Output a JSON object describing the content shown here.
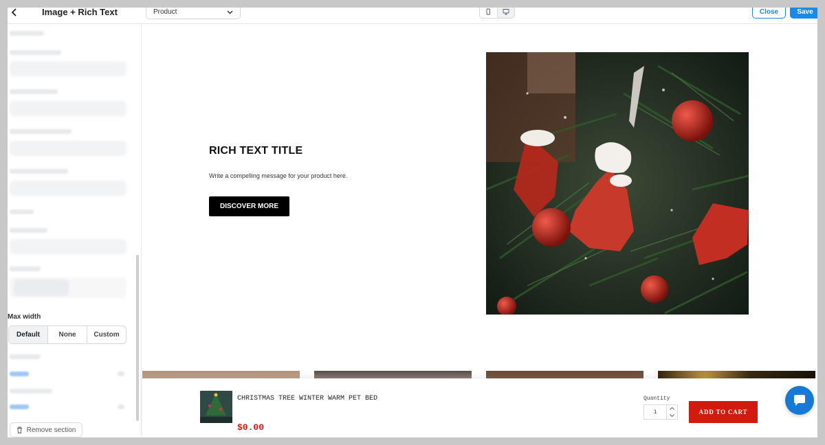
{
  "header": {
    "title": "Image + Rich Text",
    "template_select": "Product",
    "close_label": "Close",
    "save_label": "Save"
  },
  "sidebar": {
    "max_width_label": "Max width",
    "max_width_options": [
      "Default",
      "None",
      "Custom"
    ],
    "max_width_selected": "Default",
    "remove_section_label": "Remove section"
  },
  "section": {
    "title": "RICH TEXT TITLE",
    "description": "Write a compelling message for your product here.",
    "button_label": "DISCOVER MORE"
  },
  "sticky_cart": {
    "product_name": "CHRISTMAS TREE WINTER WARM PET BED",
    "price": "$0.00",
    "quantity_label": "Quantity",
    "quantity_value": "1",
    "add_to_cart_label": "ADD TO CART"
  },
  "colors": {
    "accent": "#1e88e5",
    "cart_red": "#d11c0d",
    "price_red": "#d21a0c"
  }
}
